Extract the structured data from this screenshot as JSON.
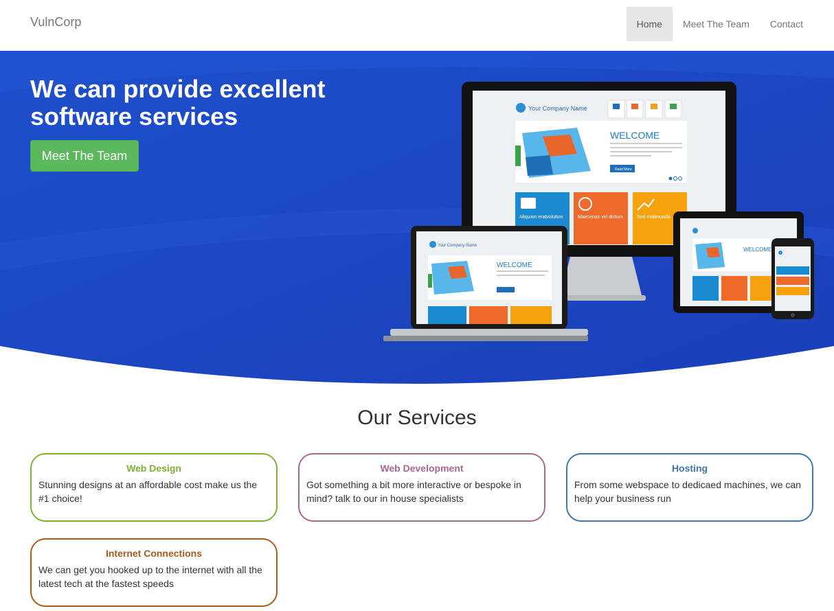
{
  "navbar": {
    "brand": "VulnCorp",
    "links": [
      {
        "label": "Home",
        "active": true
      },
      {
        "label": "Meet The Team",
        "active": false
      },
      {
        "label": "Contact",
        "active": false
      }
    ]
  },
  "hero": {
    "title": "We can provide excellent software services",
    "button_label": "Meet The Team",
    "colors": {
      "background": "#1f4fc9",
      "button": "#5cb85c"
    },
    "devices_image": {
      "company_name": "Your Company Name",
      "welcome": "WELCOME",
      "read_more": "Read More",
      "tiles": [
        "Aliquam eratvolution",
        "Maecenas vel dictum",
        "Sed malesuada"
      ],
      "home_icons": [
        "HOME",
        "ABOUT US",
        "BLOG",
        "CONTACT"
      ]
    }
  },
  "services": {
    "title": "Our Services",
    "items": [
      {
        "title": "Web Design",
        "text": "Stunning designs at an affordable cost make us the #1 choice!",
        "color": "#7db035"
      },
      {
        "title": "Web Development",
        "text": "Got something a bit more interactive or bespoke in mind? talk to our in house specialists",
        "color": "#a8688e"
      },
      {
        "title": "Hosting",
        "text": "From some webspace to dedicaed machines, we can help your business run",
        "color": "#3d77a5"
      },
      {
        "title": "Internet Connections",
        "text": "We can get you hooked up to the internet with all the latest tech at the fastest speeds",
        "color": "#a75a1d"
      }
    ]
  }
}
